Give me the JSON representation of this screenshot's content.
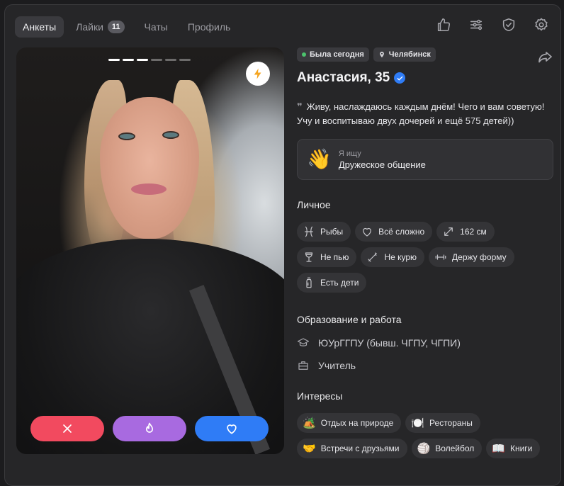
{
  "nav": {
    "tabs": [
      {
        "label": "Анкеты",
        "active": true
      },
      {
        "label": "Лайки",
        "badge": "11"
      },
      {
        "label": "Чаты"
      },
      {
        "label": "Профиль"
      }
    ]
  },
  "top_icons": [
    "thumbs-up-icon",
    "sliders-icon",
    "shield-check-icon",
    "gear-icon"
  ],
  "photo": {
    "segments_total": 6,
    "segments_active": 3
  },
  "profile": {
    "status": "Была сегодня",
    "city": "Челябинск",
    "name": "Анастасия, 35",
    "bio": "Живу, наслаждаюсь каждым днём! Чего и вам советую! Учу и воспитываю двух дочерей и ещё 575 детей))",
    "looking_label": "Я ищу",
    "looking_value": "Дружеское общение",
    "looking_emoji": "👋"
  },
  "personal": {
    "title": "Личное",
    "tags": [
      "Рыбы",
      "Всё сложно",
      "162 см",
      "Не пью",
      "Не курю",
      "Держу форму",
      "Есть дети"
    ]
  },
  "education": {
    "title": "Образование и работа",
    "school": "ЮУрГГПУ (бывш. ЧГПУ, ЧГПИ)",
    "job": "Учитель"
  },
  "interests": {
    "title": "Интересы",
    "tags": [
      {
        "emoji": "🏕️",
        "label": "Отдых на природе"
      },
      {
        "emoji": "🍽️",
        "label": "Рестораны"
      },
      {
        "emoji": "🤝",
        "label": "Встречи с друзьями"
      },
      {
        "emoji": "🏐",
        "label": "Волейбол"
      },
      {
        "emoji": "📖",
        "label": "Книги"
      }
    ]
  },
  "colors": {
    "dislike": "#f24a5f",
    "super": "#a86ae0",
    "like": "#2f7cf6",
    "online": "#4cc36d",
    "verified": "#2f7cf6"
  }
}
